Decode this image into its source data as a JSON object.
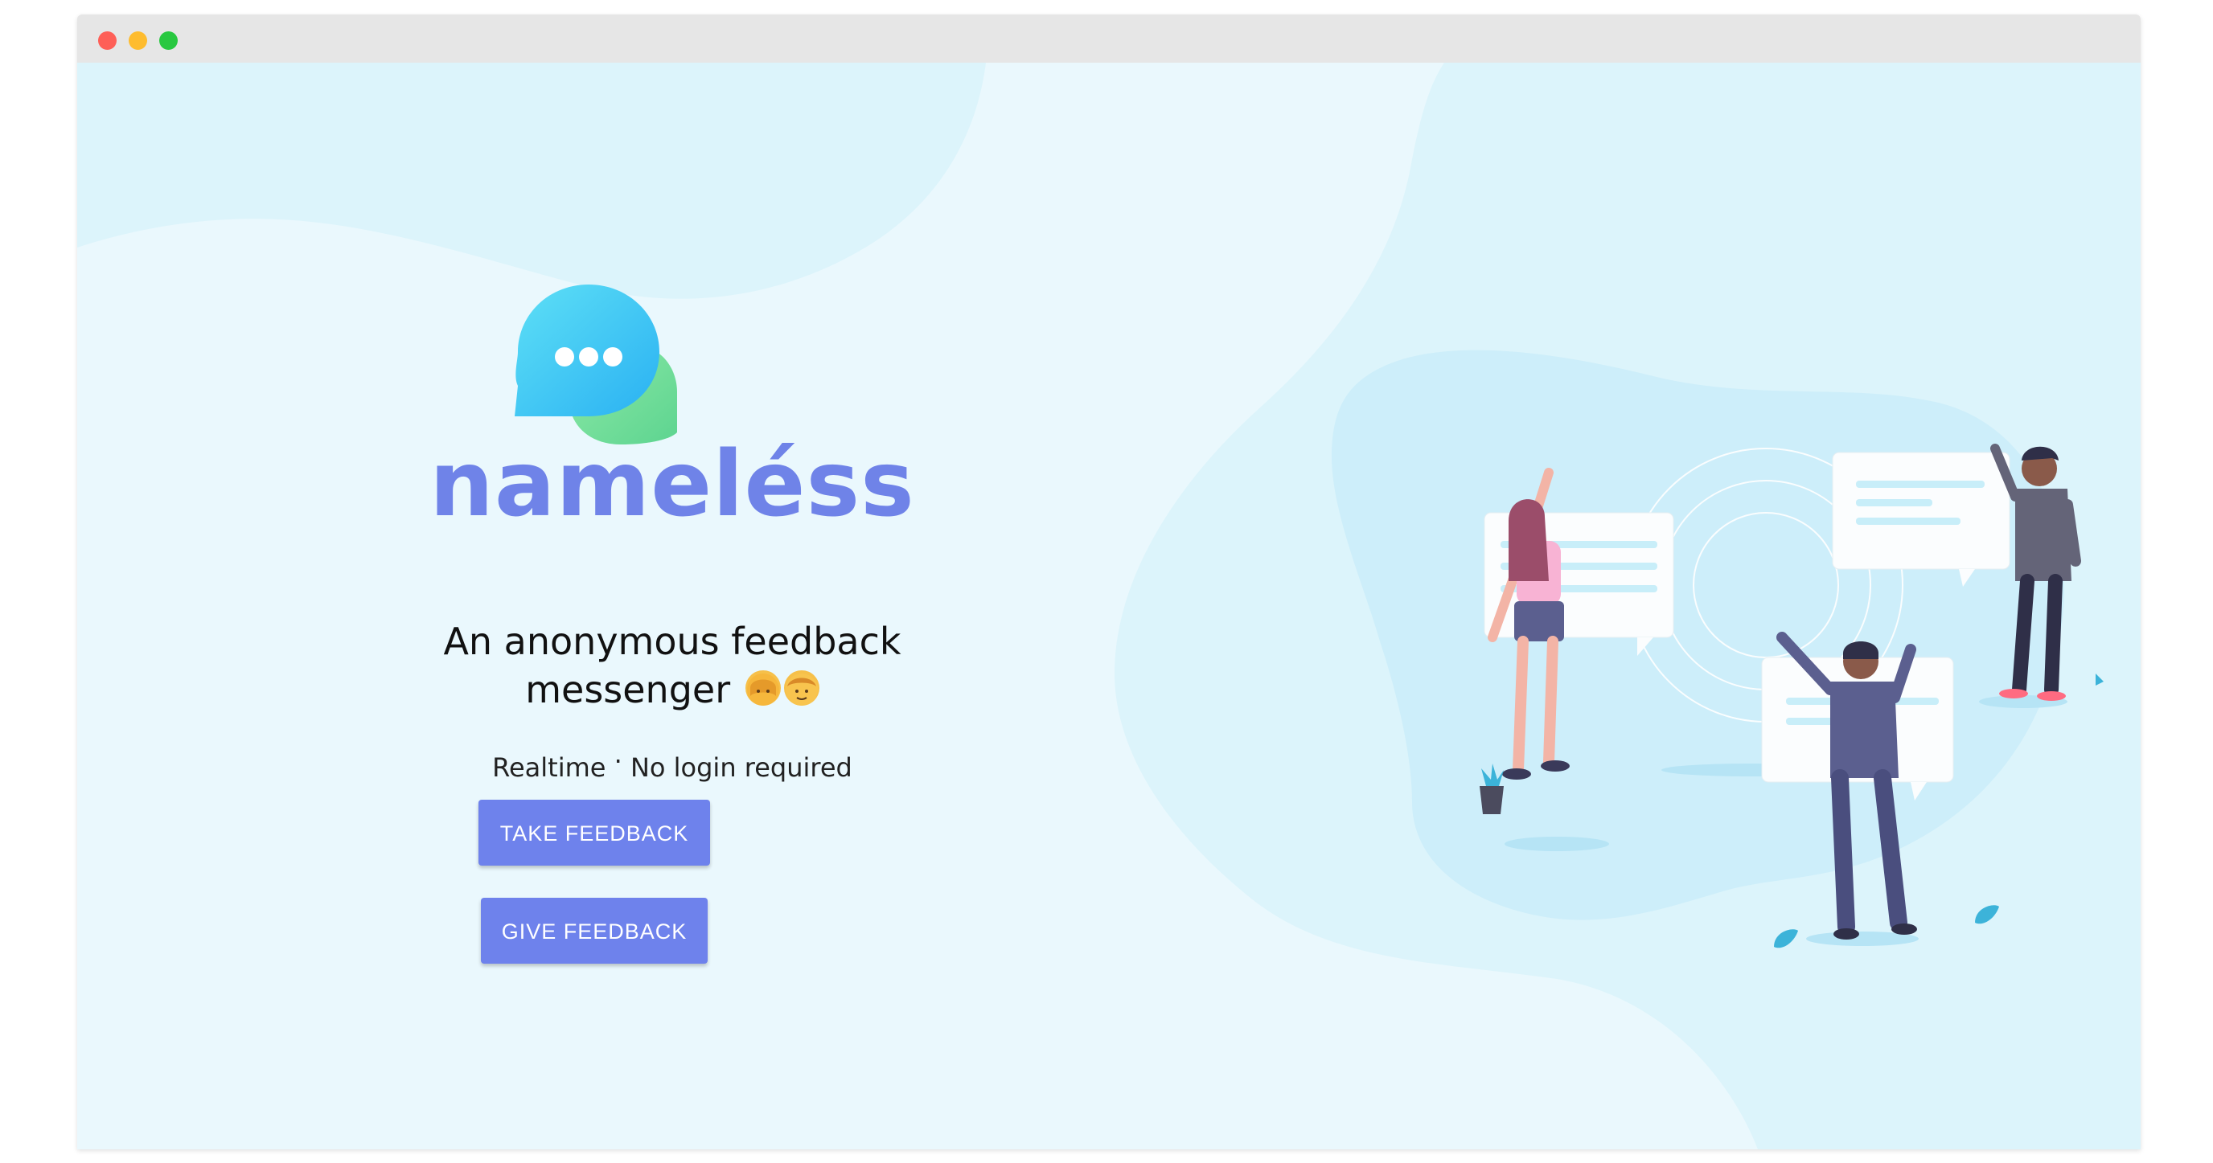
{
  "window": {
    "controls": [
      {
        "name": "close",
        "color": "#fe5f57"
      },
      {
        "name": "minimize",
        "color": "#febc2e"
      },
      {
        "name": "maximize",
        "color": "#28c840"
      }
    ]
  },
  "hero": {
    "logo_icon": "chat-bubbles-icon",
    "brand_name": "nameléss",
    "tagline_line1": "An anonymous feedback",
    "tagline_line2": "messenger",
    "tagline_emojis": [
      "woman-emoji",
      "man-emoji"
    ],
    "subline_left": "Realtime",
    "subline_separator": "·",
    "subline_right": "No login required",
    "buttons": {
      "take_feedback": "TAKE FEEDBACK",
      "give_feedback": "GIVE FEEDBACK"
    }
  },
  "colors": {
    "brand": "#6f83e8",
    "button": "#6e82ec",
    "background": "#eaf8fd",
    "blob": "#d3f1fb"
  },
  "illustration": {
    "name": "people-with-speech-bubbles-illustration"
  }
}
